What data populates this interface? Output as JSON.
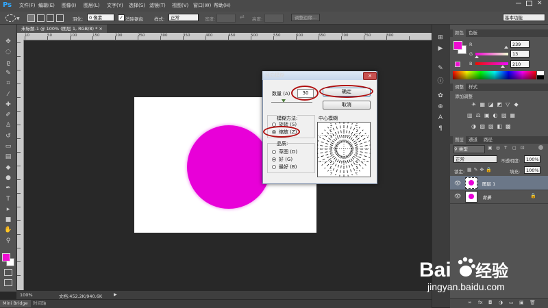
{
  "menubar": {
    "logo": "Ps",
    "items": [
      "文件(F)",
      "编辑(E)",
      "图像(I)",
      "图层(L)",
      "文字(Y)",
      "选择(S)",
      "滤镜(T)",
      "视图(V)",
      "窗口(W)",
      "帮助(H)"
    ]
  },
  "options": {
    "feather_label": "羽化:",
    "feather_value": "0 像素",
    "antialias_label": "消除锯齿",
    "style_label": "样式:",
    "style_value": "正常",
    "width_label": "宽度:",
    "height_label": "高度:",
    "refine_label": "调整边缘...",
    "workspace": "基本功能"
  },
  "document": {
    "tab_title": "未标题-1 @ 100% (图层 1, RGB/8) *",
    "ruler_numbers": [
      "10",
      "50",
      "100",
      "150",
      "200",
      "250",
      "300",
      "350",
      "400",
      "450",
      "500",
      "550",
      "600",
      "650",
      "700",
      "750",
      "800"
    ]
  },
  "status": {
    "zoom": "100%",
    "doc_info": "文档:452.2K/940.6K"
  },
  "bottom_tabs": [
    "Mini Bridge",
    "时间轴"
  ],
  "color_panel": {
    "tabs": [
      "颜色",
      "色板"
    ],
    "r_label": "R",
    "r_value": "239",
    "g_label": "G",
    "g_value": "13",
    "b_label": "B",
    "b_value": "210",
    "r_fraction": 0.937,
    "g_fraction": 0.051,
    "b_fraction": 0.824
  },
  "adjust_panel": {
    "tabs": [
      "调整",
      "样式"
    ],
    "title": "添加调整"
  },
  "layers_panel": {
    "tabs": [
      "图层",
      "通道",
      "路径"
    ],
    "kind_label": "类型",
    "blend_mode": "正常",
    "opacity_label": "不透明度:",
    "opacity_value": "100%",
    "lock_label": "锁定:",
    "fill_label": "填充:",
    "fill_value": "100%",
    "layers": [
      {
        "name": "图层 1",
        "selected": true
      },
      {
        "name": "背景",
        "selected": false
      }
    ]
  },
  "dialog": {
    "title": "径向模糊",
    "amount_label": "数量 (A)",
    "amount_value": "30",
    "ok_label": "确定",
    "cancel_label": "取消",
    "method_label": "模糊方法:",
    "method_spin": "旋转 (S)",
    "method_zoom": "缩放 (Z)",
    "quality_label": "品质:",
    "quality_draft": "草图 (D)",
    "quality_good": "好 (G)",
    "quality_best": "最好 (B)",
    "center_label": "中心模糊",
    "amount_fraction": 0.3
  },
  "watermark": {
    "brand": "Bai",
    "brand_cn": "经验",
    "url": "jingyan.baidu.com"
  },
  "colors": {
    "accent_magenta": "#ef0dd2",
    "highlight_red": "#b01010"
  }
}
